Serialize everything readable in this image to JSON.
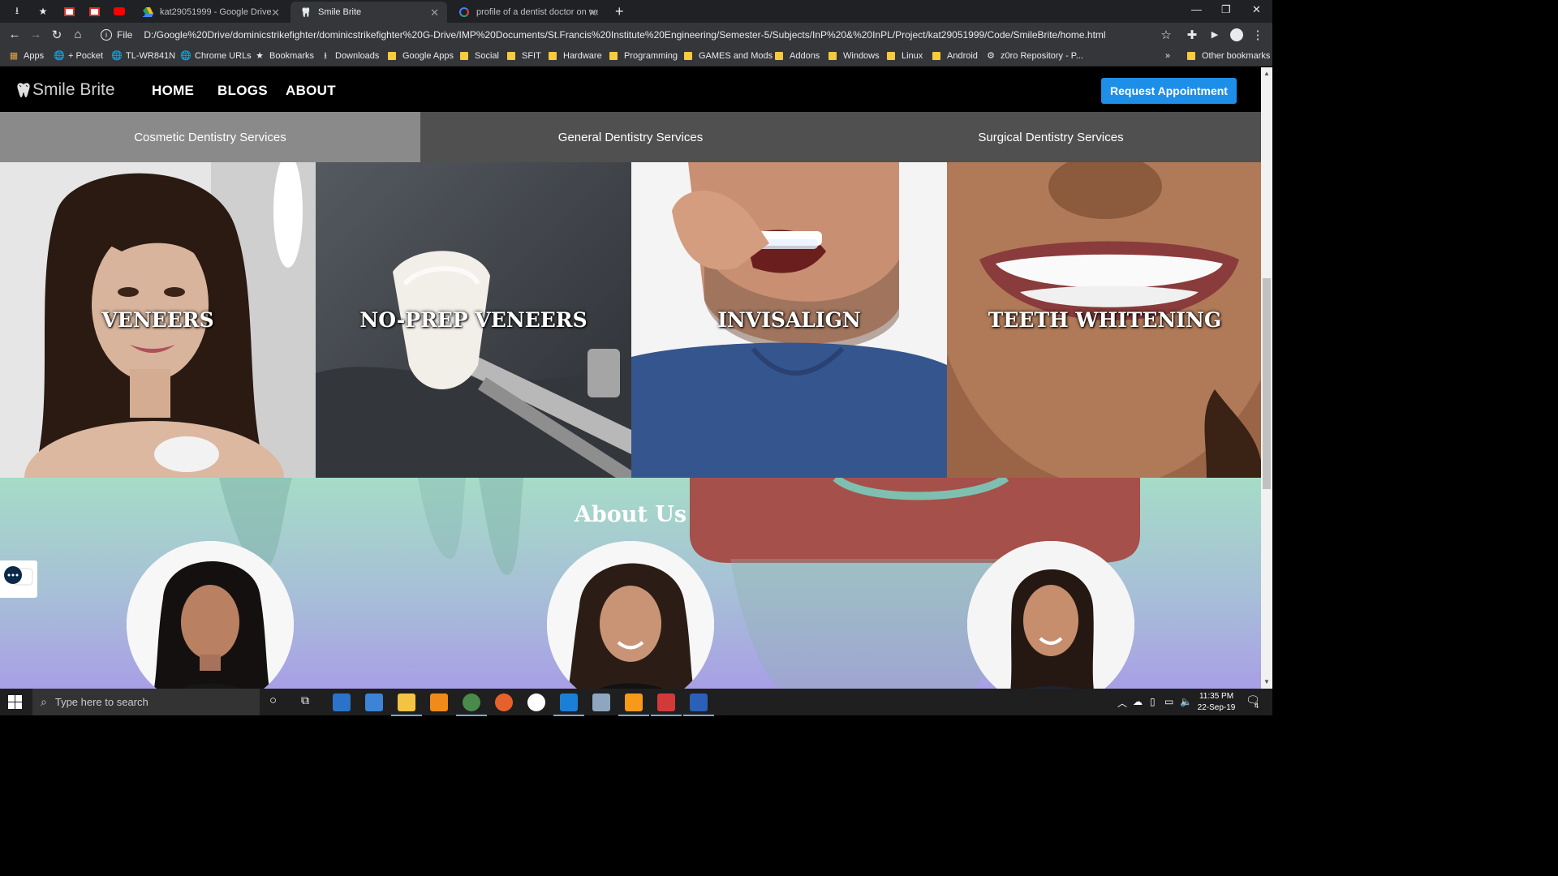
{
  "browser": {
    "tabs": [
      {
        "title": "kat29051999 - Google Drive",
        "active": false
      },
      {
        "title": "Smile Brite",
        "active": true
      },
      {
        "title": "profile of a dentist doctor on wel",
        "active": false
      }
    ],
    "address": {
      "scheme_label": "File",
      "url": "D:/Google%20Drive/dominicstrikefighter/dominicstrikefighter%20G-Drive/IMP%20Documents/St.Francis%20Institute%20Engineering/Semester-5/Subjects/InP%20&%20InPL/Project/kat29051999/Code/SmileBrite/home.html"
    },
    "bookmarks": [
      {
        "label": "Apps",
        "icon": "apps-grid-icon"
      },
      {
        "label": "+ Pocket",
        "icon": "globe-icon"
      },
      {
        "label": "TL-WR841N",
        "icon": "globe-icon"
      },
      {
        "label": "Chrome URLs",
        "icon": "globe-icon"
      },
      {
        "label": "Bookmarks",
        "icon": "star-icon"
      },
      {
        "label": "Downloads",
        "icon": "download-icon"
      },
      {
        "label": "Google Apps",
        "icon": "folder-icon"
      },
      {
        "label": "Social",
        "icon": "folder-icon"
      },
      {
        "label": "SFIT",
        "icon": "folder-icon"
      },
      {
        "label": "Hardware",
        "icon": "folder-icon"
      },
      {
        "label": "Programming",
        "icon": "folder-icon"
      },
      {
        "label": "GAMES and Mods",
        "icon": "folder-icon"
      },
      {
        "label": "Addons",
        "icon": "folder-icon"
      },
      {
        "label": "Windows",
        "icon": "folder-icon"
      },
      {
        "label": "Linux",
        "icon": "folder-icon"
      },
      {
        "label": "Android",
        "icon": "folder-icon"
      },
      {
        "label": "z0ro Repository - P...",
        "icon": "gear-icon"
      }
    ],
    "overflow": "»",
    "other_bookmarks": "Other bookmarks"
  },
  "site": {
    "logo_text": "Smile Brite",
    "nav": [
      "HOME",
      "BLOGS",
      "ABOUT"
    ],
    "cta": "Request Appointment",
    "service_tabs": [
      {
        "label": "Cosmetic Dentistry Services",
        "selected": true
      },
      {
        "label": "General Dentistry Services",
        "selected": false
      },
      {
        "label": "Surgical Dentistry Services",
        "selected": false
      }
    ],
    "tiles": [
      {
        "label": "VENEERS",
        "image": "woman-smiling-portrait"
      },
      {
        "label": "NO-PREP VENEERS",
        "image": "veneer-held-by-tweezers"
      },
      {
        "label": "INVISALIGN",
        "image": "man-inserting-clear-aligner"
      },
      {
        "label": "TEETH WHITENING",
        "image": "close-up-white-smile"
      }
    ],
    "about_title": "About Us",
    "team_photos": [
      "team-member-1",
      "team-member-2",
      "team-member-3"
    ]
  },
  "taskbar": {
    "search_placeholder": "Type here to search",
    "time": "11:35 PM",
    "date": "22-Sep-19",
    "notification_count": "4"
  },
  "colors": {
    "cta_blue": "#1e8fe9",
    "tab_selected": "#8a8a8a",
    "tab_bar": "#505050",
    "about_gradient_top": "#a6dcc7",
    "about_gradient_bottom": "#a89fe6"
  }
}
